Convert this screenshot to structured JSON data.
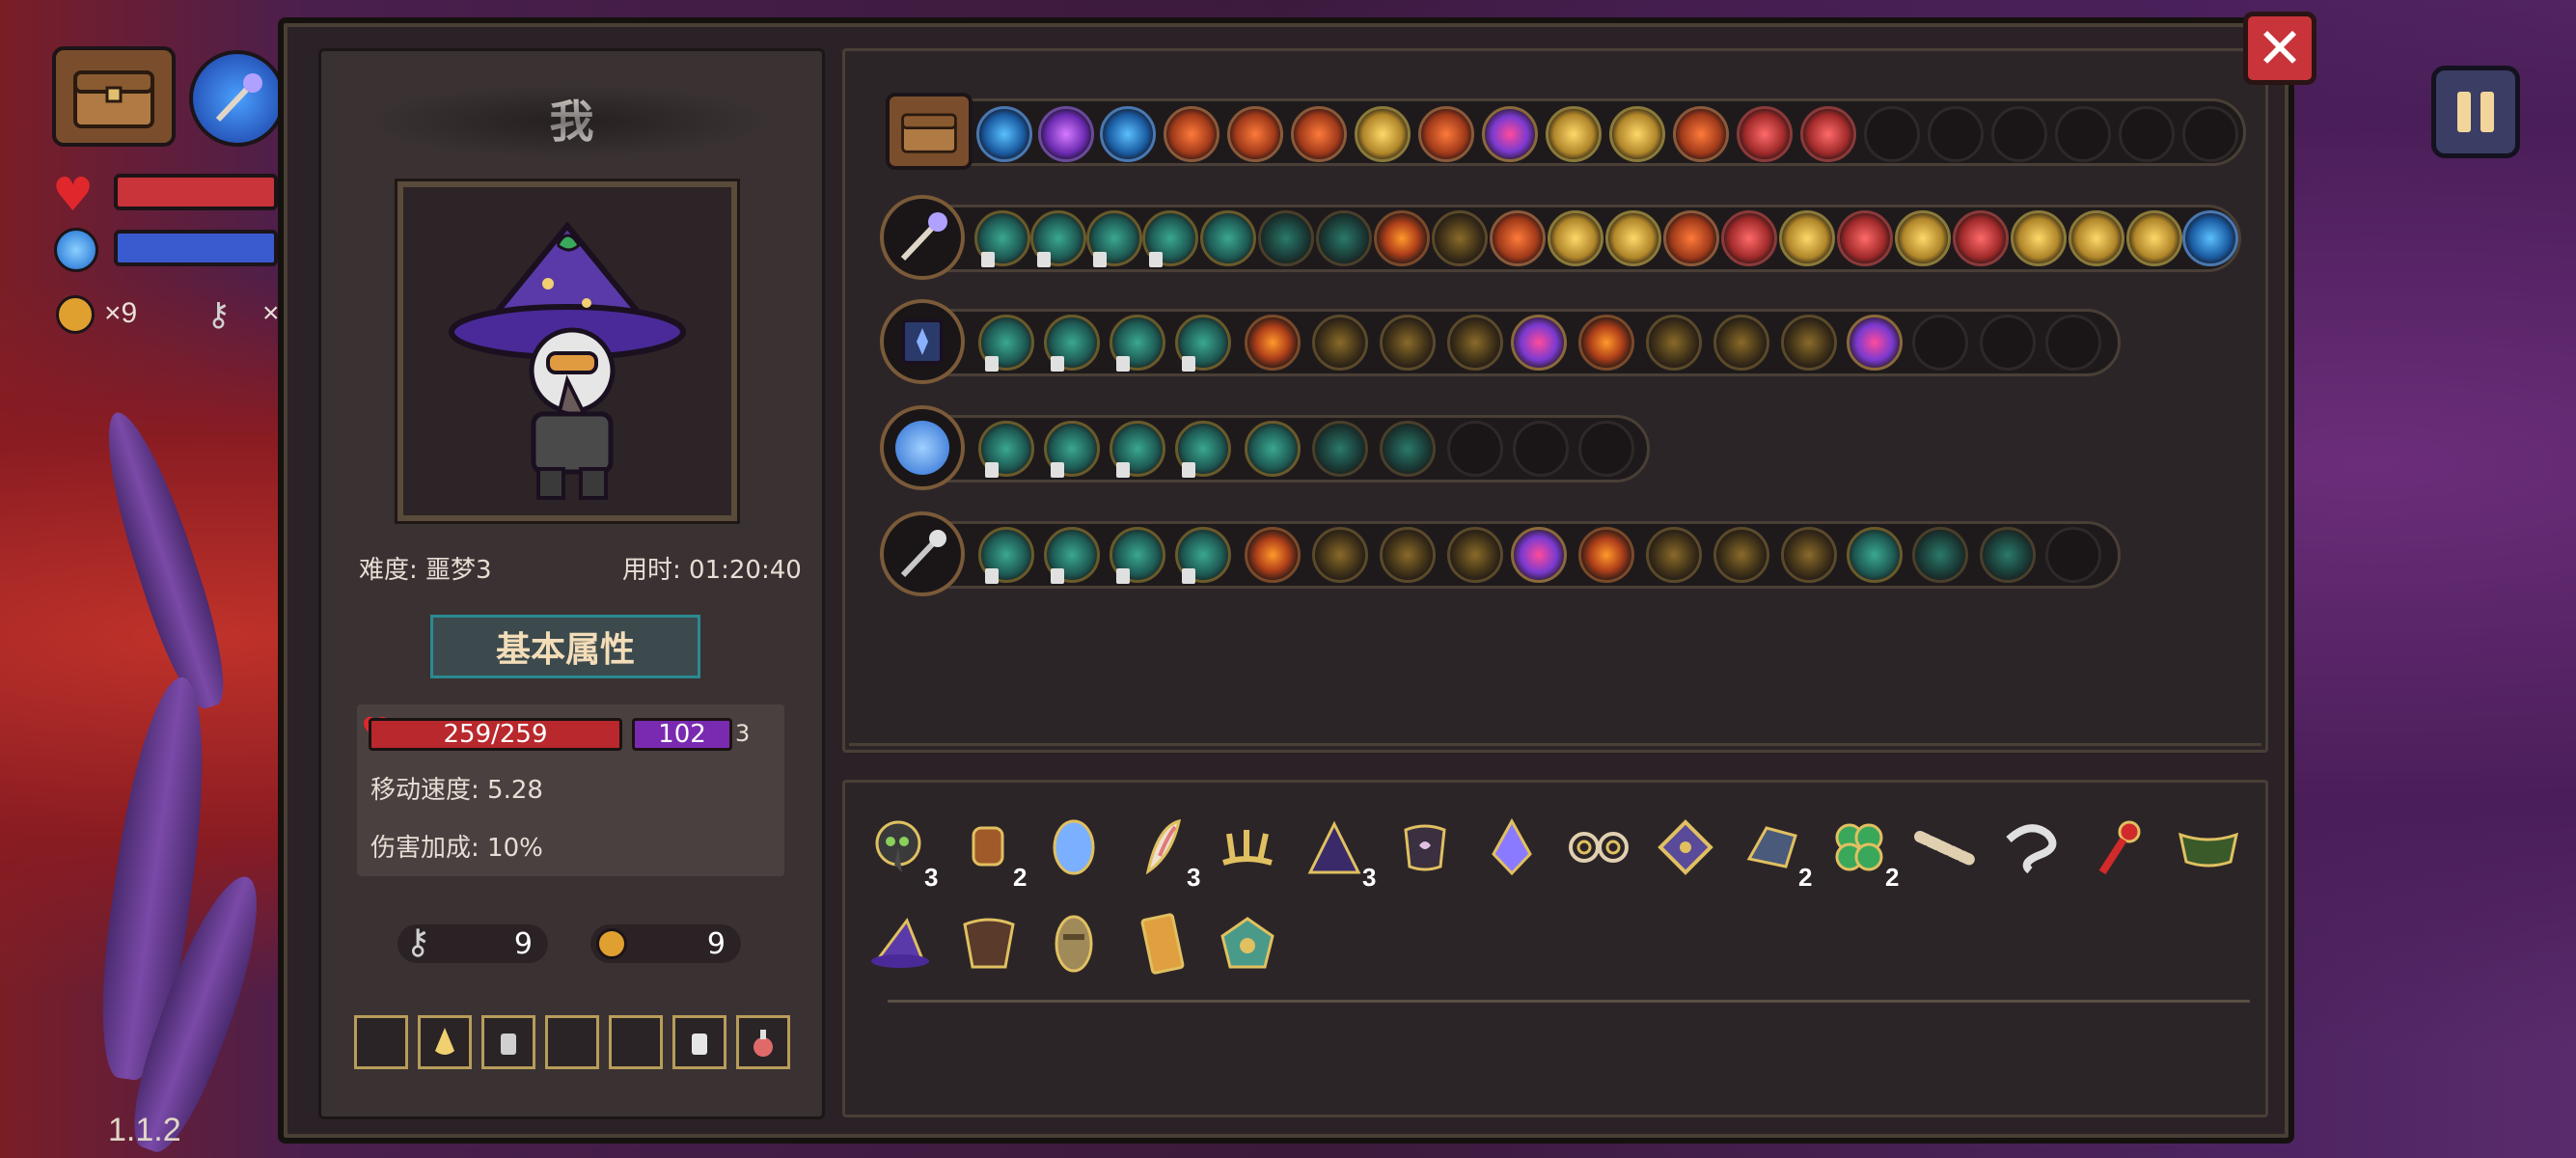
{
  "player": {
    "name": "我",
    "difficulty": "难度: 噩梦3",
    "time": "用时: 01:20:40",
    "stats_tab": "基本属性",
    "hp": "259/259",
    "mp": "102",
    "extra": "3",
    "move_speed": "移动速度: 5.28",
    "damage_bonus": "伤害加成: 10%",
    "keys": "9",
    "coins": "9"
  },
  "hud": {
    "coins_label": "×9",
    "keys_label": "×",
    "version": "1.1.2"
  },
  "item_counts": [
    "3",
    "2",
    "3",
    "3",
    "2",
    "2"
  ],
  "colors": {
    "panel_bg": "#2a2226",
    "hp": "#b8282c",
    "mp": "#7a2ab0",
    "accent_teal": "#2a8a92",
    "close_red": "#c8343a"
  },
  "icons": {
    "close": "close-icon",
    "pause": "pause-icon",
    "bag": "bag-icon",
    "heart": "heart-icon",
    "key": "key-icon",
    "coin": "coin-icon"
  }
}
